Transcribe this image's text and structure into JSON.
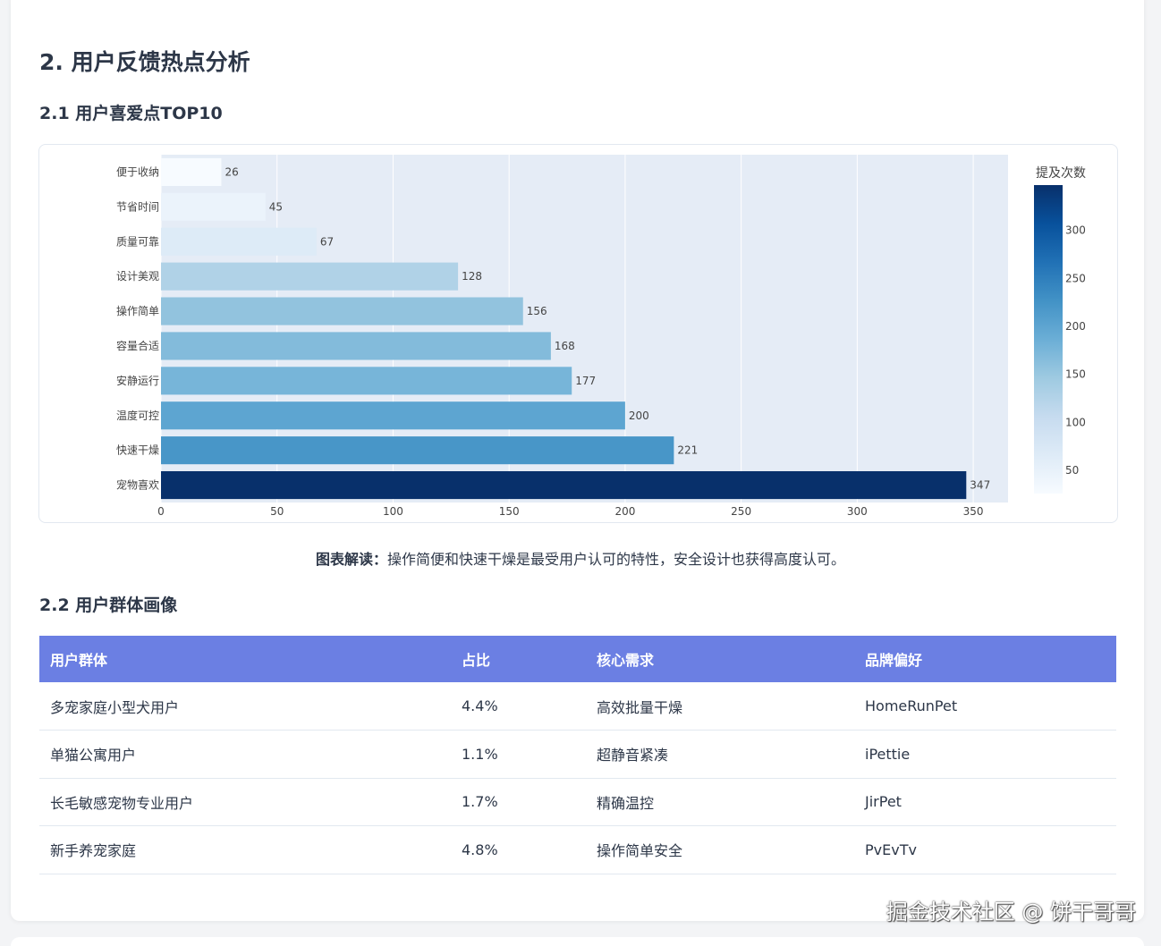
{
  "section": {
    "title": "2. 用户反馈热点分析",
    "sub1": "2.1 用户喜爱点TOP10",
    "sub2": "2.2 用户群体画像"
  },
  "chart_data": {
    "type": "bar",
    "orientation": "horizontal",
    "categories": [
      "便于收纳",
      "节省时间",
      "质量可靠",
      "设计美观",
      "操作简单",
      "容量合适",
      "安静运行",
      "温度可控",
      "快速干燥",
      "宠物喜欢"
    ],
    "values": [
      26,
      45,
      67,
      128,
      156,
      168,
      177,
      200,
      221,
      347
    ],
    "xlim": [
      0,
      365
    ],
    "xticks": [
      0,
      50,
      100,
      150,
      200,
      250,
      300,
      350
    ],
    "grid": true,
    "colorscale": {
      "title": "提及次数",
      "range": [
        26,
        347
      ],
      "ticks": [
        50,
        100,
        150,
        200,
        250,
        300
      ],
      "colors": [
        "#f7fbff",
        "#deebf7",
        "#c6dbef",
        "#9ecae1",
        "#6baed6",
        "#4292c6",
        "#2171b5",
        "#08519c",
        "#08306b"
      ]
    }
  },
  "note": {
    "label": "图表解读：",
    "text": "操作简便和快速干燥是最受用户认可的特性，安全设计也获得高度认可。"
  },
  "table": {
    "headers": [
      "用户群体",
      "占比",
      "核心需求",
      "品牌偏好"
    ],
    "rows": [
      [
        "多宠家庭小型犬用户",
        "4.4%",
        "高效批量干燥",
        "HomeRunPet"
      ],
      [
        "单猫公寓用户",
        "1.1%",
        "超静音紧凑",
        "iPettie"
      ],
      [
        "长毛敏感宠物专业用户",
        "1.7%",
        "精确温控",
        "JirPet"
      ],
      [
        "新手养宠家庭",
        "4.8%",
        "操作简单安全",
        "PvEvTv"
      ]
    ]
  },
  "watermark": "掘金技术社区 @ 饼干哥哥"
}
